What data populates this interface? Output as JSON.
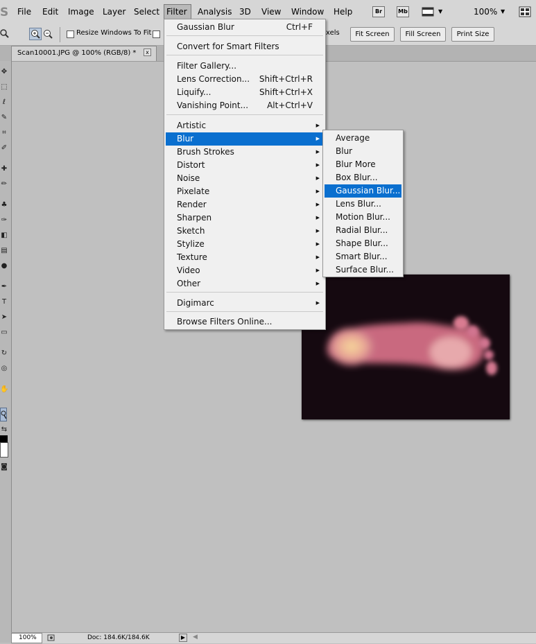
{
  "menubar": {
    "items": [
      "File",
      "Edit",
      "Image",
      "Layer",
      "Select",
      "Filter",
      "Analysis",
      "3D",
      "View",
      "Window",
      "Help"
    ],
    "right": {
      "br": "Br",
      "mb": "Mb",
      "zoom": "100%"
    }
  },
  "options": {
    "resize_label": "Resize Windows To Fit",
    "pixels_label": "xels",
    "fit_screen": "Fit Screen",
    "fill_screen": "Fill Screen",
    "print_size": "Print Size"
  },
  "document": {
    "tab_title": "Scan10001.JPG @ 100% (RGB/8) *",
    "close": "x"
  },
  "status": {
    "zoom": "100%",
    "doc": "Doc: 184.6K/184.6K"
  },
  "filter_menu": {
    "last_filter": {
      "label": "Gaussian Blur",
      "shortcut": "Ctrl+F"
    },
    "smart": "Convert for Smart Filters",
    "group1": [
      {
        "label": "Filter Gallery...",
        "shortcut": ""
      },
      {
        "label": "Lens Correction...",
        "shortcut": "Shift+Ctrl+R"
      },
      {
        "label": "Liquify...",
        "shortcut": "Shift+Ctrl+X"
      },
      {
        "label": "Vanishing Point...",
        "shortcut": "Alt+Ctrl+V"
      }
    ],
    "submenus": [
      "Artistic",
      "Blur",
      "Brush Strokes",
      "Distort",
      "Noise",
      "Pixelate",
      "Render",
      "Sharpen",
      "Sketch",
      "Stylize",
      "Texture",
      "Video",
      "Other"
    ],
    "digimarc": "Digimarc",
    "browse": "Browse Filters Online..."
  },
  "blur_menu": [
    "Average",
    "Blur",
    "Blur More",
    "Box Blur...",
    "Gaussian Blur...",
    "Lens Blur...",
    "Motion Blur...",
    "Radial Blur...",
    "Shape Blur...",
    "Smart Blur...",
    "Surface Blur..."
  ],
  "colors": {
    "highlight": "#0a6fcf",
    "menu_bg": "#f0f0f0",
    "canvas": "#c0c0c0"
  }
}
